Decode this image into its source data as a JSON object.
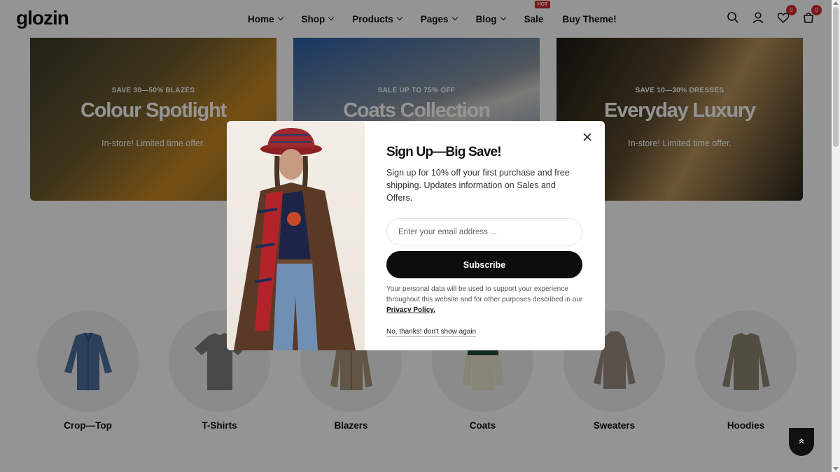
{
  "header": {
    "logo": "glozin",
    "nav": [
      {
        "label": "Home",
        "dropdown": true
      },
      {
        "label": "Shop",
        "dropdown": true
      },
      {
        "label": "Products",
        "dropdown": true
      },
      {
        "label": "Pages",
        "dropdown": true
      },
      {
        "label": "Blog",
        "dropdown": true
      },
      {
        "label": "Sale",
        "dropdown": false,
        "badge": "HOT"
      },
      {
        "label": "Buy Theme!",
        "dropdown": false
      }
    ],
    "wishlist_count": "0",
    "cart_count": "0",
    "icons": [
      "search-icon",
      "account-icon",
      "wishlist-icon",
      "cart-icon"
    ]
  },
  "banners": [
    {
      "tag": "SAVE 30—50% BLAZES",
      "title": "Colour Spotlight",
      "subtitle": "In-store! Limited time offer."
    },
    {
      "tag": "SALE UP TO 75% OFF",
      "title": "Coats Collection",
      "subtitle": ""
    },
    {
      "tag": "SAVE 10—30% DRESSES",
      "title": "Everyday Luxury",
      "subtitle": "In-store! Limited time offer."
    }
  ],
  "categories": [
    {
      "label": "Crop—Top",
      "color": "#4d6e9e"
    },
    {
      "label": "T-Shirts",
      "color": "#7d7d7d"
    },
    {
      "label": "Blazers",
      "color": "#a89478"
    },
    {
      "label": "Coats",
      "color": "#1f4d3a"
    },
    {
      "label": "Sweaters",
      "color": "#9b8a80"
    },
    {
      "label": "Hoodies",
      "color": "#8e8670"
    }
  ],
  "modal": {
    "title": "Sign Up—Big Save!",
    "description": "Sign up for 10% off your first purchase and free shipping. Updates information on Sales and Offers.",
    "email_placeholder": "Enter your email address ...",
    "subscribe_label": "Subscribe",
    "privacy_text": "Your personal data will be used to support your experience throughout this website and for other purposes described in our",
    "privacy_link": "Privacy Policy.",
    "dismiss_label": "No, thanks! don't show again"
  },
  "colors": {
    "accent": "#d4282f",
    "button": "#0d0d0d"
  }
}
